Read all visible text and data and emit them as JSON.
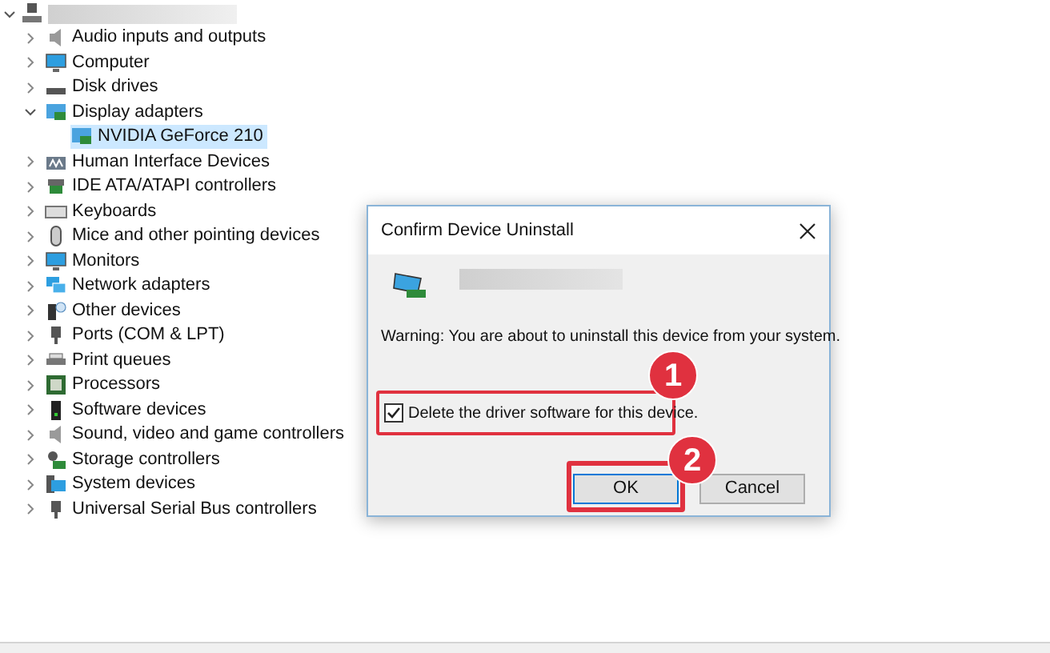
{
  "tree": {
    "expanded": true,
    "children": [
      {
        "label": "Audio inputs and outputs",
        "kind": "speaker",
        "expanded": false,
        "selected": false
      },
      {
        "label": "Computer",
        "kind": "monitor",
        "expanded": false,
        "selected": false
      },
      {
        "label": "Disk drives",
        "kind": "drive",
        "expanded": false,
        "selected": false
      },
      {
        "label": "Display adapters",
        "kind": "display",
        "expanded": true,
        "selected": false,
        "children": [
          {
            "label": "NVIDIA GeForce 210",
            "kind": "display",
            "selected": true
          }
        ]
      },
      {
        "label": "Human Interface Devices",
        "kind": "hid",
        "expanded": false,
        "selected": false
      },
      {
        "label": "IDE ATA/ATAPI controllers",
        "kind": "ide",
        "expanded": false,
        "selected": false
      },
      {
        "label": "Keyboards",
        "kind": "keyboard",
        "expanded": false,
        "selected": false
      },
      {
        "label": "Mice and other pointing devices",
        "kind": "mouse",
        "expanded": false,
        "selected": false
      },
      {
        "label": "Monitors",
        "kind": "monitor",
        "expanded": false,
        "selected": false
      },
      {
        "label": "Network adapters",
        "kind": "network",
        "expanded": false,
        "selected": false
      },
      {
        "label": "Other devices",
        "kind": "other",
        "expanded": false,
        "selected": false
      },
      {
        "label": "Ports (COM & LPT)",
        "kind": "plug",
        "expanded": false,
        "selected": false
      },
      {
        "label": "Print queues",
        "kind": "printer",
        "expanded": false,
        "selected": false
      },
      {
        "label": "Processors",
        "kind": "chip",
        "expanded": false,
        "selected": false
      },
      {
        "label": "Software devices",
        "kind": "tower",
        "expanded": false,
        "selected": false
      },
      {
        "label": "Sound, video and game controllers",
        "kind": "speaker",
        "expanded": false,
        "selected": false
      },
      {
        "label": "Storage controllers",
        "kind": "storage",
        "expanded": false,
        "selected": false
      },
      {
        "label": "System devices",
        "kind": "folder",
        "expanded": false,
        "selected": false
      },
      {
        "label": "Universal Serial Bus controllers",
        "kind": "plug",
        "expanded": false,
        "selected": false
      }
    ]
  },
  "dialog": {
    "title": "Confirm Device Uninstall",
    "warning": "Warning: You are about to uninstall this device from your system.",
    "checkbox": {
      "label": "Delete the driver software for this device.",
      "checked": true
    },
    "buttons": [
      {
        "label": "OK",
        "kind": "default"
      },
      {
        "label": "Cancel",
        "kind": "normal"
      }
    ]
  },
  "annotations": [
    "1",
    "2"
  ]
}
